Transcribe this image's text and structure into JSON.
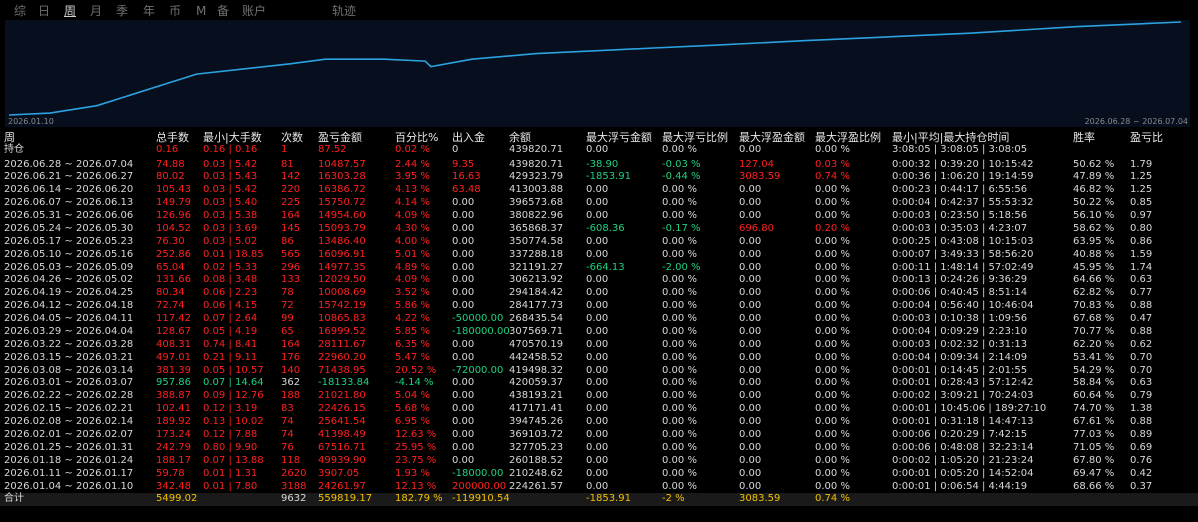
{
  "tabs": [
    "综",
    "日",
    "周",
    "月",
    "季",
    "年",
    "币",
    "M",
    "备",
    "账户",
    "轨迹"
  ],
  "active_tab": "周",
  "chart_data": {
    "type": "line",
    "series": [
      {
        "values": [
          0.0,
          0.02,
          0.1,
          0.44,
          0.55,
          0.6,
          0.6,
          0.58,
          0.52,
          0.6,
          0.66,
          0.69,
          0.72,
          0.75,
          0.8,
          0.84,
          0.88,
          0.95,
          1.0
        ]
      }
    ],
    "x_start": "2026.01.10",
    "x_end": "2026.06.28 ~ 2026.07.04",
    "color": "#2ba3e0"
  },
  "headers": [
    "周",
    "总手数",
    "最小|大手数",
    "次数",
    "盈亏金额",
    "百分比%",
    "出入金",
    "余额",
    "最大浮亏金额",
    "最大浮亏比例",
    "最大浮盈金额",
    "最大浮盈比例",
    "最小|平均|最大持仓时间",
    "胜率",
    "盈亏比"
  ],
  "holding_row": [
    "持仓",
    "0.16",
    "0.16 | 0.16",
    "1",
    "87.52",
    "0.02 %",
    "0",
    "439820.71",
    "0.00",
    "0.00 %",
    "0.00",
    "0.00 %",
    "3:08:05 | 3:08:05 | 3:08:05",
    "",
    ""
  ],
  "rows": [
    [
      "2026.06.28 ~ 2026.07.04",
      "74.88",
      "0.03 | 5.42",
      "81",
      "10487.57",
      "2.44 %",
      "9.35",
      "439820.71",
      "-38.90",
      "-0.03 %",
      "127.04",
      "0.03 %",
      "0:00:32 | 0:39:20 | 10:15:42",
      "50.62 %",
      "1.79"
    ],
    [
      "2026.06.21 ~ 2026.06.27",
      "80.02",
      "0.03 | 5.43",
      "142",
      "16303.28",
      "3.95 %",
      "16.63",
      "429323.79",
      "-1853.91",
      "-0.44 %",
      "3083.59",
      "0.74 %",
      "0:00:36 | 1:06:20 | 19:14:59",
      "47.89 %",
      "1.25"
    ],
    [
      "2026.06.14 ~ 2026.06.20",
      "105.43",
      "0.03 | 5.42",
      "220",
      "16386.72",
      "4.13 %",
      "63.48",
      "413003.88",
      "0.00",
      "0.00 %",
      "0.00",
      "0.00 %",
      "0:00:23 | 0:44:17 | 6:55:56",
      "46.82 %",
      "1.25"
    ],
    [
      "2026.06.07 ~ 2026.06.13",
      "149.79",
      "0.03 | 5.40",
      "225",
      "15750.72",
      "4.14 %",
      "0.00",
      "396573.68",
      "0.00",
      "0.00 %",
      "0.00",
      "0.00 %",
      "0:00:04 | 0:42:37 | 55:53:32",
      "50.22 %",
      "0.85"
    ],
    [
      "2026.05.31 ~ 2026.06.06",
      "126.96",
      "0.03 | 5.38",
      "164",
      "14954.60",
      "4.09 %",
      "0.00",
      "380822.96",
      "0.00",
      "0.00 %",
      "0.00",
      "0.00 %",
      "0:00:03 | 0:23:50 | 5:18:56",
      "56.10 %",
      "0.97"
    ],
    [
      "2026.05.24 ~ 2026.05.30",
      "104.52",
      "0.03 | 3.69",
      "145",
      "15093.79",
      "4.30 %",
      "0.00",
      "365868.37",
      "-608.36",
      "-0.17 %",
      "696.80",
      "0.20 %",
      "0:00:03 | 0:35:03 | 4:23:07",
      "58.62 %",
      "0.80"
    ],
    [
      "2026.05.17 ~ 2026.05.23",
      "76.30",
      "0.03 | 5.02",
      "86",
      "13486.40",
      "4.00 %",
      "0.00",
      "350774.58",
      "0.00",
      "0.00 %",
      "0.00",
      "0.00 %",
      "0:00:25 | 0:43:08 | 10:15:03",
      "63.95 %",
      "0.86"
    ],
    [
      "2026.05.10 ~ 2026.05.16",
      "252.86",
      "0.01 | 18.85",
      "565",
      "16096.91",
      "5.01 %",
      "0.00",
      "337288.18",
      "0.00",
      "0.00 %",
      "0.00",
      "0.00 %",
      "0:00:07 | 3:49:33 | 58:56:20",
      "40.88 %",
      "1.59"
    ],
    [
      "2026.05.03 ~ 2026.05.09",
      "65.04",
      "0.02 | 5.33",
      "296",
      "14977.35",
      "4.89 %",
      "0.00",
      "321191.27",
      "-664.13",
      "-2.00 %",
      "0.00",
      "0.00 %",
      "0:00:11 | 1:48:14 | 57:02:49",
      "45.95 %",
      "1.74"
    ],
    [
      "2026.04.26 ~ 2026.05.02",
      "131.66",
      "0.08 | 3.48",
      "133",
      "12029.50",
      "4.09 %",
      "0.00",
      "306213.92",
      "0.00",
      "0.00 %",
      "0.00",
      "0.00 %",
      "0:00:13 | 0:24:26 | 9:36:29",
      "64.66 %",
      "0.63"
    ],
    [
      "2026.04.19 ~ 2026.04.25",
      "80.34",
      "0.06 | 2.23",
      "78",
      "10008.69",
      "3.52 %",
      "0.00",
      "294184.42",
      "0.00",
      "0.00 %",
      "0.00",
      "0.00 %",
      "0:00:06 | 0:40:45 | 8:51:14",
      "62.82 %",
      "0.77"
    ],
    [
      "2026.04.12 ~ 2026.04.18",
      "72.74",
      "0.06 | 4.15",
      "72",
      "15742.19",
      "5.86 %",
      "0.00",
      "284177.73",
      "0.00",
      "0.00 %",
      "0.00",
      "0.00 %",
      "0:00:04 | 0:56:40 | 10:46:04",
      "70.83 %",
      "0.88"
    ],
    [
      "2026.04.05 ~ 2026.04.11",
      "117.42",
      "0.07 | 2.64",
      "99",
      "10865.83",
      "4.22 %",
      "-50000.00",
      "268435.54",
      "0.00",
      "0.00 %",
      "0.00",
      "0.00 %",
      "0:00:03 | 0:10:38 | 1:09:56",
      "67.68 %",
      "0.47"
    ],
    [
      "2026.03.29 ~ 2026.04.04",
      "128.67",
      "0.05 | 4.19",
      "65",
      "16999.52",
      "5.85 %",
      "-180000.00",
      "307569.71",
      "0.00",
      "0.00 %",
      "0.00",
      "0.00 %",
      "0:00:04 | 0:09:29 | 2:23:10",
      "70.77 %",
      "0.88"
    ],
    [
      "2026.03.22 ~ 2026.03.28",
      "408.31",
      "0.74 | 8.41",
      "164",
      "28111.67",
      "6.35 %",
      "0.00",
      "470570.19",
      "0.00",
      "0.00 %",
      "0.00",
      "0.00 %",
      "0:00:03 | 0:02:32 | 0:31:13",
      "62.20 %",
      "0.62"
    ],
    [
      "2026.03.15 ~ 2026.03.21",
      "497.01",
      "0.21 | 9.11",
      "176",
      "22960.20",
      "5.47 %",
      "0.00",
      "442458.52",
      "0.00",
      "0.00 %",
      "0.00",
      "0.00 %",
      "0:00:04 | 0:09:34 | 2:14:09",
      "53.41 %",
      "0.70"
    ],
    [
      "2026.03.08 ~ 2026.03.14",
      "381.39",
      "0.05 | 10.57",
      "140",
      "71438.95",
      "20.52 %",
      "-72000.00",
      "419498.32",
      "0.00",
      "0.00 %",
      "0.00",
      "0.00 %",
      "0:00:01 | 0:14:45 | 2:01:55",
      "54.29 %",
      "0.70"
    ],
    [
      "2026.03.01 ~ 2026.03.07",
      "957.86",
      "0.07 | 14.64",
      "362",
      "-18133.84",
      "-4.14 %",
      "0.00",
      "420059.37",
      "0.00",
      "0.00 %",
      "0.00",
      "0.00 %",
      "0:00:01 | 0:28:43 | 57:12:42",
      "58.84 %",
      "0.63"
    ],
    [
      "2026.02.22 ~ 2026.02.28",
      "388.87",
      "0.09 | 12.76",
      "188",
      "21021.80",
      "5.04 %",
      "0.00",
      "438193.21",
      "0.00",
      "0.00 %",
      "0.00",
      "0.00 %",
      "0:00:02 | 3:09:21 | 70:24:03",
      "60.64 %",
      "0.79"
    ],
    [
      "2026.02.15 ~ 2026.02.21",
      "102.41",
      "0.12 | 3.19",
      "83",
      "22426.15",
      "5.68 %",
      "0.00",
      "417171.41",
      "0.00",
      "0.00 %",
      "0.00",
      "0.00 %",
      "0:00:01 | 10:45:06 | 189:27:10",
      "74.70 %",
      "1.38"
    ],
    [
      "2026.02.08 ~ 2026.02.14",
      "189.92",
      "0.13 | 10.02",
      "74",
      "25641.54",
      "6.95 %",
      "0.00",
      "394745.26",
      "0.00",
      "0.00 %",
      "0.00",
      "0.00 %",
      "0:00:01 | 0:31:18 | 14:47:13",
      "67.61 %",
      "0.88"
    ],
    [
      "2026.02.01 ~ 2026.02.07",
      "173.24",
      "0.12 | 7.88",
      "74",
      "41398.49",
      "12.63 %",
      "0.00",
      "369103.72",
      "0.00",
      "0.00 %",
      "0.00",
      "0.00 %",
      "0:00:06 | 0:20:29 | 7:42:15",
      "77.03 %",
      "0.89"
    ],
    [
      "2026.01.25 ~ 2026.01.31",
      "242.79",
      "0.80 | 9.90",
      "76",
      "67516.71",
      "25.95 %",
      "0.00",
      "327705.23",
      "0.00",
      "0.00 %",
      "0.00",
      "0.00 %",
      "0:00:06 | 0:48:08 | 32:23:14",
      "71.05 %",
      "0.69"
    ],
    [
      "2026.01.18 ~ 2026.01.24",
      "188.17",
      "0.07 | 13.88",
      "118",
      "49939.90",
      "23.75 %",
      "0.00",
      "260188.52",
      "0.00",
      "0.00 %",
      "0.00",
      "0.00 %",
      "0:00:02 | 1:05:20 | 21:23:24",
      "67.80 %",
      "0.76"
    ],
    [
      "2026.01.11 ~ 2026.01.17",
      "59.78",
      "0.01 | 1.31",
      "2620",
      "3907.05",
      "1.93 %",
      "-18000.00",
      "210248.62",
      "0.00",
      "0.00 %",
      "0.00",
      "0.00 %",
      "0:00:01 | 0:05:20 | 14:52:04",
      "69.47 %",
      "0.42"
    ],
    [
      "2026.01.04 ~ 2026.01.10",
      "342.48",
      "0.01 | 7.80",
      "3188",
      "24261.97",
      "12.13 %",
      "200000.00",
      "224261.57",
      "0.00",
      "0.00 %",
      "0.00",
      "0.00 %",
      "0:00:01 | 0:06:54 | 4:44:19",
      "68.66 %",
      "0.37"
    ]
  ],
  "total_row": [
    "合计",
    "5499.02",
    "",
    "9632",
    "559819.17",
    "182.79 %",
    "-119910.54",
    "",
    "-1853.91",
    "-2 %",
    "3083.59",
    "0.74 %",
    "",
    "",
    ""
  ],
  "colors": {
    "text": "#d8d8d8",
    "positive": "#ff2020",
    "negative": "#20d080",
    "total": "#f0c000",
    "line": "#2ba3e0",
    "chart_bg": "#070e1d"
  }
}
